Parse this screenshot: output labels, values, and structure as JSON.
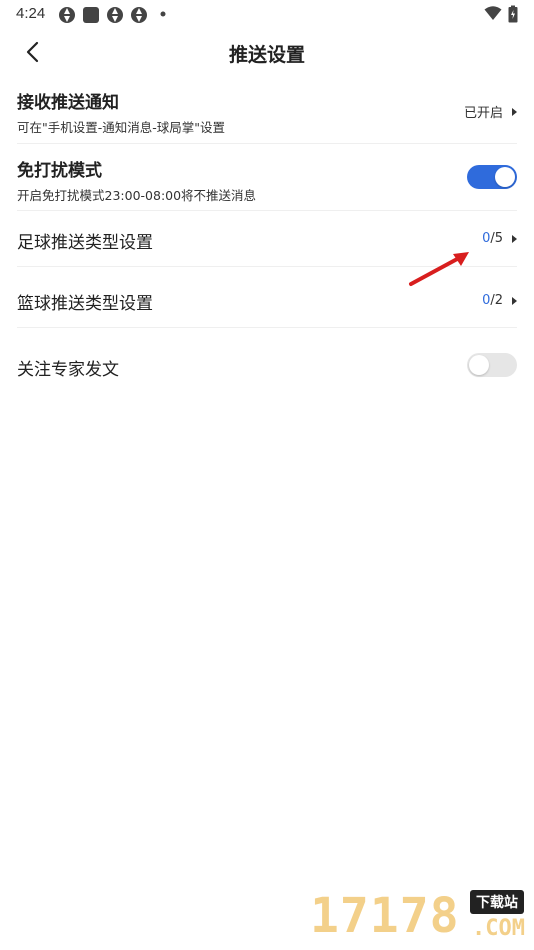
{
  "status_bar": {
    "time": "4:24"
  },
  "header": {
    "title": "推送设置"
  },
  "settings": {
    "receive_push": {
      "title": "接收推送通知",
      "subtitle": "可在\"手机设置-通知消息-球局掌\"设置",
      "value": "已开启"
    },
    "dnd_mode": {
      "title": "免打扰模式",
      "subtitle": "开启免打扰模式23:00-08:00将不推送消息",
      "enabled": true
    },
    "football_push": {
      "title": "足球推送类型设置",
      "selected": "0",
      "total": "/5"
    },
    "basketball_push": {
      "title": "篮球推送类型设置",
      "selected": "0",
      "total": "/2"
    },
    "follow_expert": {
      "title": "关注专家发文",
      "enabled": false
    }
  },
  "colors": {
    "accent": "#2f6bdc",
    "annotation_arrow": "#d81e1e"
  },
  "watermark": {
    "digits": "17178",
    "badge": "下载站",
    "suffix": ".COM"
  }
}
